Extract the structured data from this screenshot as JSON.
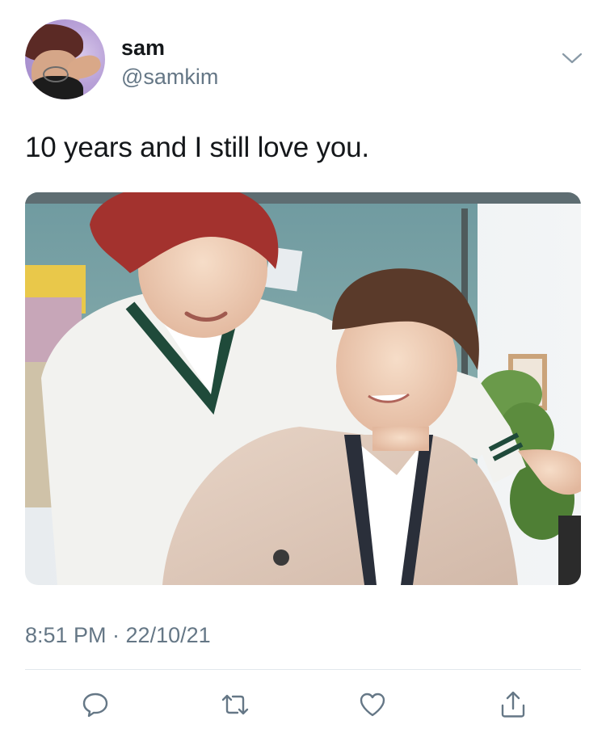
{
  "user": {
    "name": "sam",
    "handle": "@samkim"
  },
  "tweet": {
    "text": "10 years and I still love you.",
    "timestamp": "8:51 PM · 22/10/21"
  },
  "icons": {
    "menu": "chevron-down-icon",
    "reply": "reply-icon",
    "retweet": "retweet-icon",
    "like": "heart-icon",
    "share": "share-icon"
  },
  "colors": {
    "text": "#14171a",
    "secondary": "#657786",
    "divider": "#e1e8ed"
  }
}
